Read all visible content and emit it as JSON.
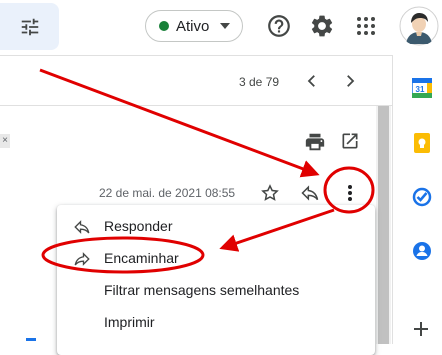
{
  "toolbar": {
    "filter_icon": "tune-icon",
    "status": {
      "label": "Ativo",
      "color": "#188038"
    },
    "help_icon": "help-icon",
    "settings_icon": "gear-icon",
    "apps_icon": "apps-grid-icon",
    "avatar_icon": "user-avatar-icon"
  },
  "pager": {
    "text": "3 de 79"
  },
  "message": {
    "date": "22 de mai. de 2021 08:55",
    "tag_close": "×"
  },
  "menu": {
    "items": [
      {
        "label": "Responder",
        "icon": "reply-icon"
      },
      {
        "label": "Encaminhar",
        "icon": "forward-icon"
      },
      {
        "label": "Filtrar mensagens semelhantes",
        "icon": ""
      },
      {
        "label": "Imprimir",
        "icon": ""
      }
    ]
  },
  "side_panel": {
    "apps": [
      "calendar-icon",
      "keep-icon",
      "tasks-icon",
      "contacts-icon",
      "add-icon"
    ],
    "calendar_day": "31"
  },
  "colors": {
    "annotation": "#e00000",
    "accent": "#1a73e8"
  }
}
